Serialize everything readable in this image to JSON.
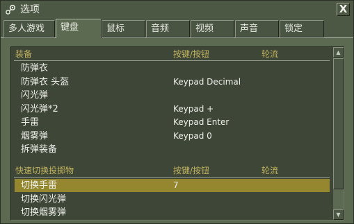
{
  "window": {
    "title": "选项",
    "close_label": "X"
  },
  "tabs": [
    "多人游戏",
    "键盘",
    "鼠标",
    "音频",
    "视频",
    "声音",
    "锁定"
  ],
  "active_tab": "键盘",
  "columns": {
    "action": "按键/按钮",
    "alt": "轮流"
  },
  "sections": [
    {
      "title": "装备",
      "rows": [
        {
          "action": "防弹衣",
          "key": ""
        },
        {
          "action": "防弹衣 头盔",
          "key": "Keypad Decimal"
        },
        {
          "action": "闪光弹",
          "key": ""
        },
        {
          "action": "闪光弹*2",
          "key": "Keypad +"
        },
        {
          "action": "手雷",
          "key": "Keypad Enter"
        },
        {
          "action": "烟雾弹",
          "key": "Keypad 0"
        },
        {
          "action": "拆弹装备",
          "key": ""
        }
      ]
    },
    {
      "title": "快速切换投掷物",
      "rows": [
        {
          "action": "切换手雷",
          "key": "7",
          "selected": true
        },
        {
          "action": "切换闪光弹",
          "key": ""
        },
        {
          "action": "切换烟雾弹",
          "key": ""
        }
      ]
    }
  ],
  "scrollbar": {
    "up_icon": "▲",
    "down_icon": "▼"
  }
}
